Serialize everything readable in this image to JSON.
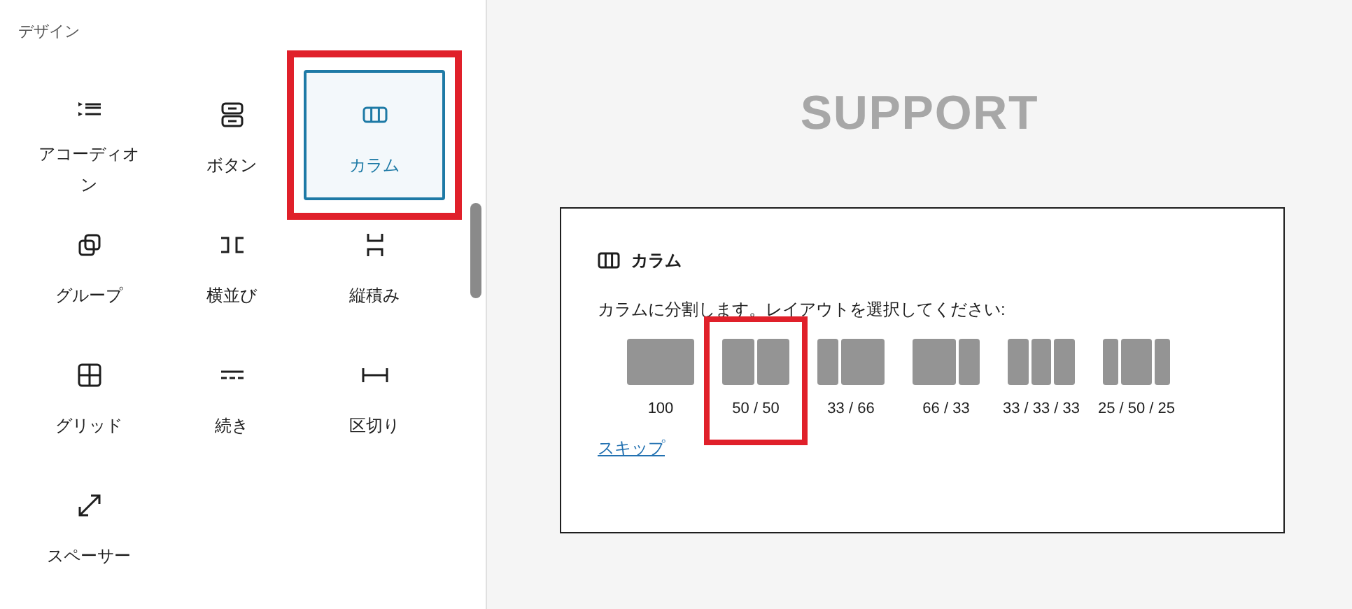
{
  "inserter": {
    "category": "デザイン",
    "blocks": [
      {
        "label": "アコーディオン",
        "selected": false,
        "annotated": false
      },
      {
        "label": "ボタン",
        "selected": false,
        "annotated": false
      },
      {
        "label": "カラム",
        "selected": true,
        "annotated": true
      },
      {
        "label": "グループ",
        "selected": false,
        "annotated": false
      },
      {
        "label": "横並び",
        "selected": false,
        "annotated": false
      },
      {
        "label": "縦積み",
        "selected": false,
        "annotated": false
      },
      {
        "label": "グリッド",
        "selected": false,
        "annotated": false
      },
      {
        "label": "続き",
        "selected": false,
        "annotated": false
      },
      {
        "label": "区切り",
        "selected": false,
        "annotated": false
      },
      {
        "label": "スペーサー",
        "selected": false,
        "annotated": false
      }
    ]
  },
  "canvas": {
    "heading": "SUPPORT",
    "placeholder": {
      "title": "カラム",
      "description": "カラムに分割します。レイアウトを選択してください:",
      "layouts": [
        {
          "label": "100",
          "annotated": false
        },
        {
          "label": "50 / 50",
          "annotated": true
        },
        {
          "label": "33 / 66",
          "annotated": false
        },
        {
          "label": "66 / 33",
          "annotated": false
        },
        {
          "label": "33 / 33 / 33",
          "annotated": false
        },
        {
          "label": "25 / 50 / 25",
          "annotated": false
        }
      ],
      "skip_link": "スキップ"
    }
  }
}
